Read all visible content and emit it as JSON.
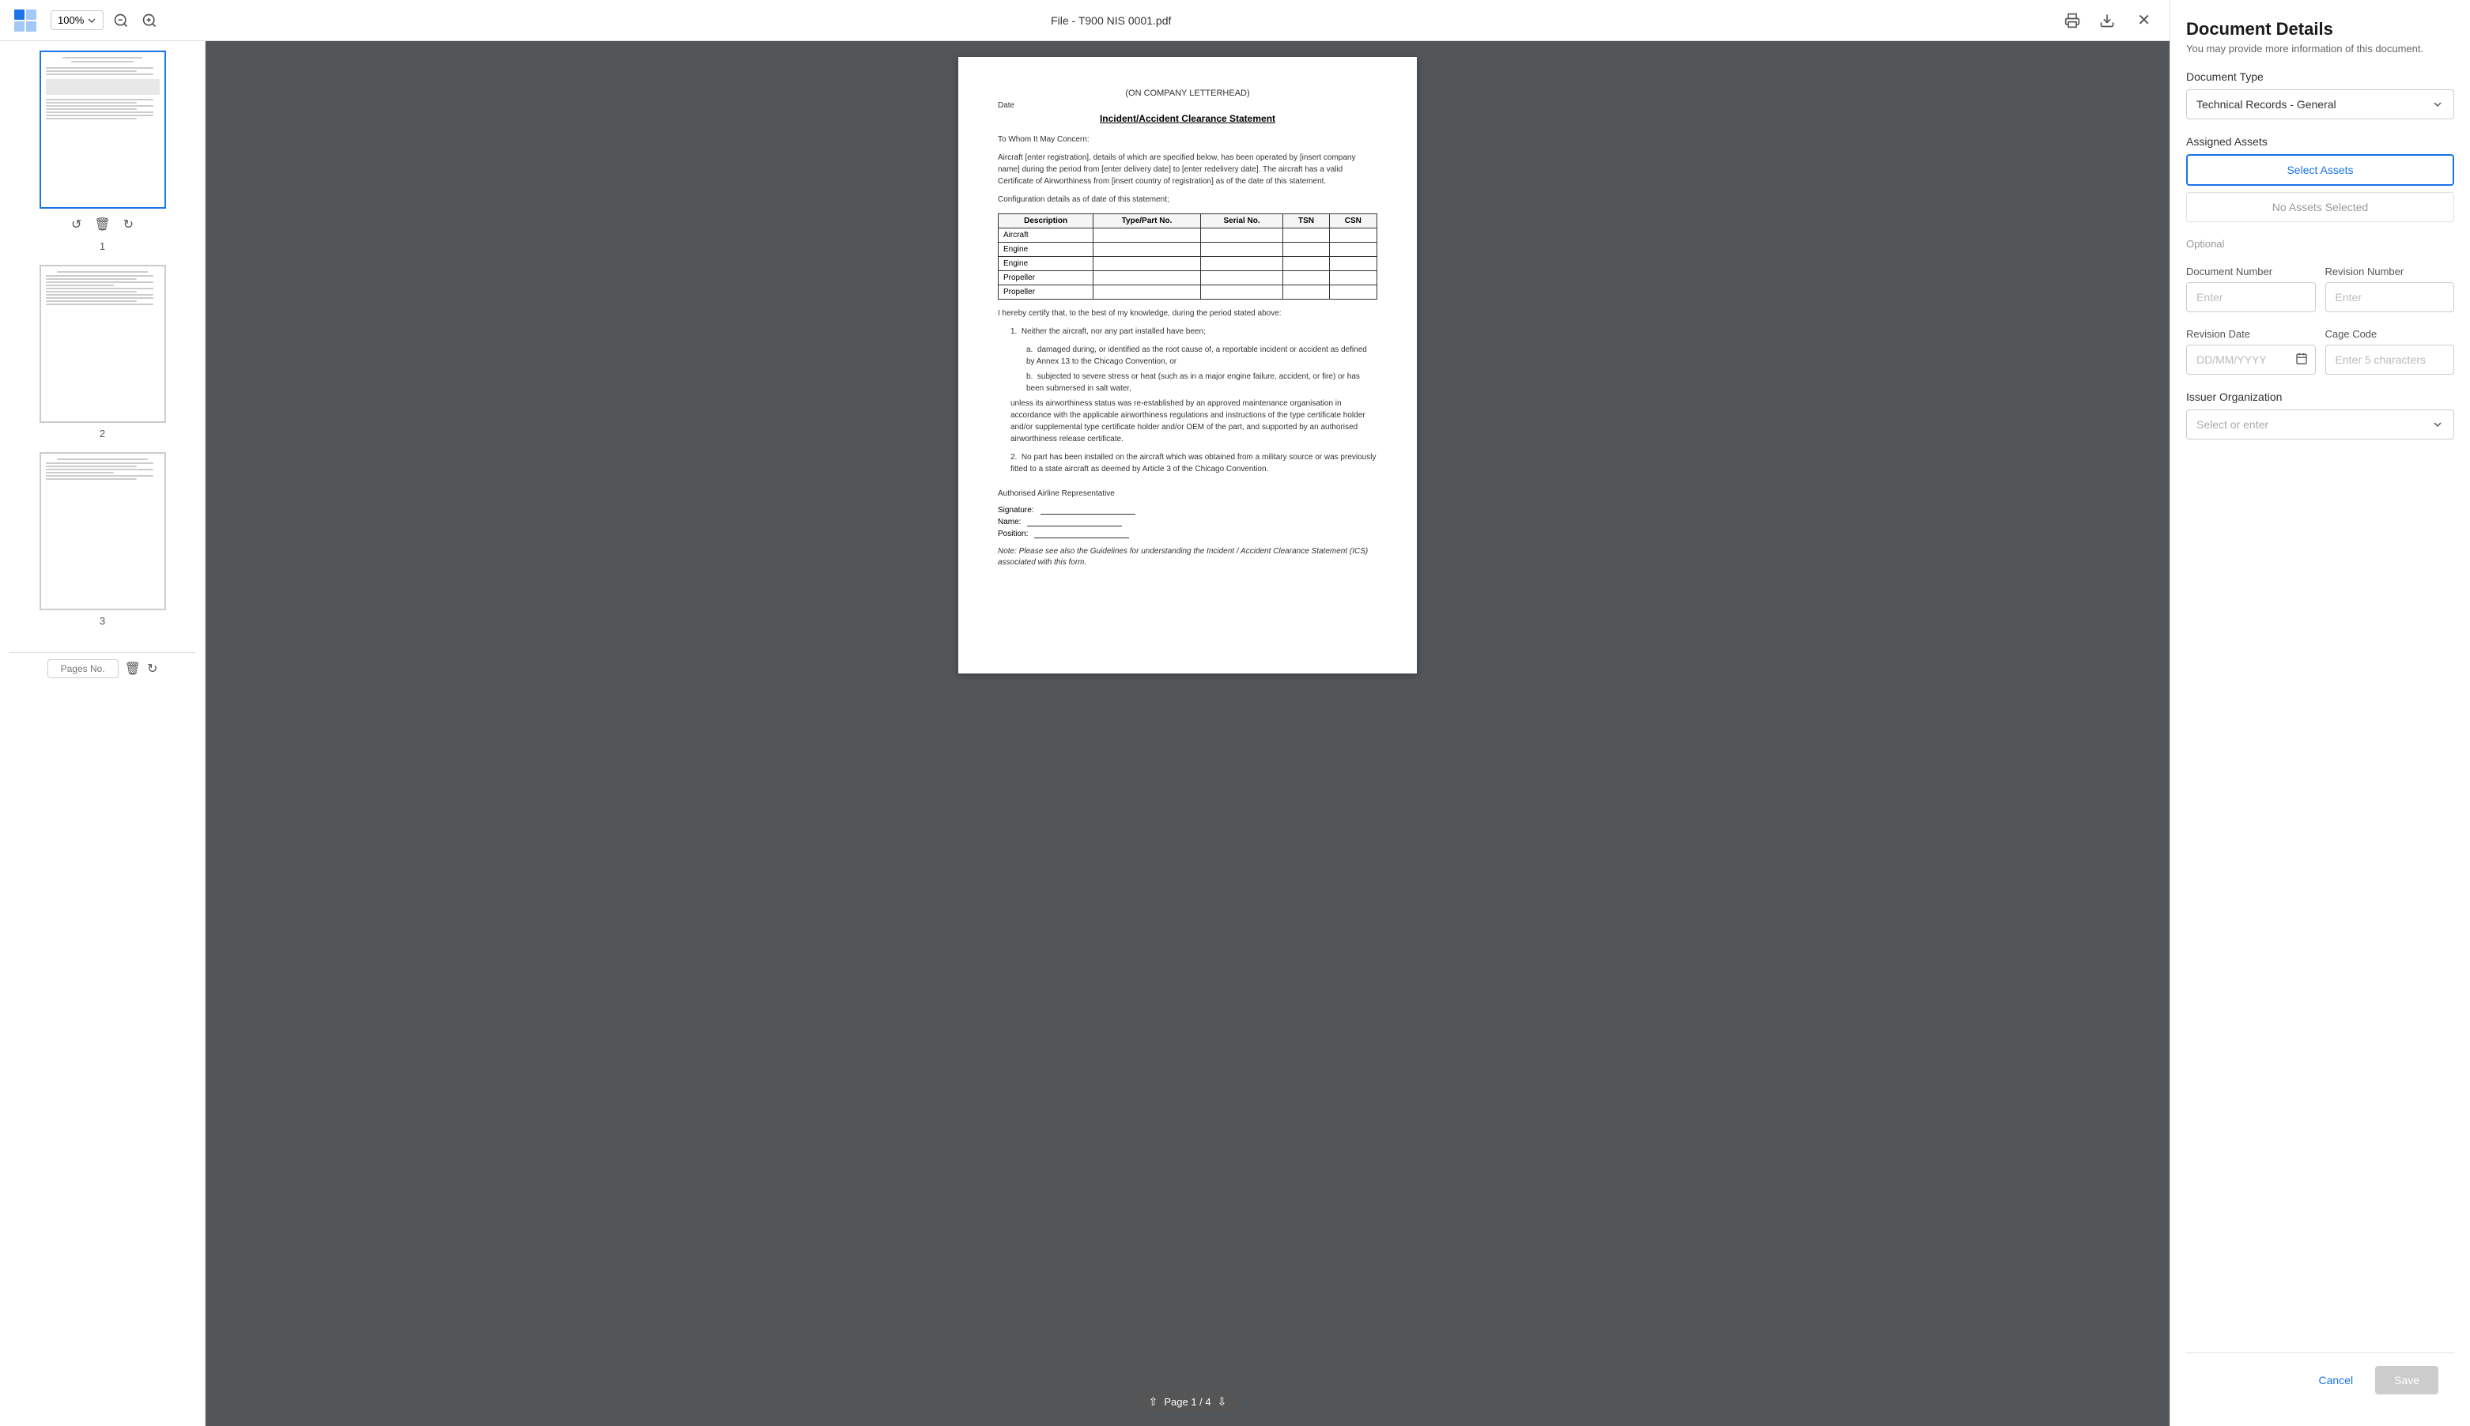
{
  "toolbar": {
    "zoom_level": "100%",
    "file_name": "File - T900 NIS 0001.pdf",
    "zoom_icon_in": "🔍+",
    "zoom_icon_out": "🔍-"
  },
  "thumbnails": [
    {
      "label": "1",
      "active": true
    },
    {
      "label": "2",
      "active": false
    },
    {
      "label": "3",
      "active": false
    }
  ],
  "bottom_bar": {
    "pages_label": "Pages No."
  },
  "pdf": {
    "letterhead": "(ON COMPANY LETTERHEAD)",
    "date_label": "Date",
    "title": "Incident/Accident Clearance Statement",
    "to_whom": "To Whom It May Concern:",
    "body1": "Aircraft [enter registration], details of which are specified below, has been operated by [insert company name] during the period from [enter delivery date] to [enter redelivery date]. The aircraft has a valid Certificate of Airworthiness from [insert country of registration] as of the date of this statement.",
    "config": "Configuration details as of date of this statement;",
    "table": {
      "headers": [
        "Description",
        "Type/Part No.",
        "Serial No.",
        "TSN",
        "CSN"
      ],
      "rows": [
        [
          "Aircraft",
          "",
          "",
          "",
          ""
        ],
        [
          "Engine",
          "",
          "",
          "",
          ""
        ],
        [
          "Engine",
          "",
          "",
          "",
          ""
        ],
        [
          "Propeller",
          "",
          "",
          "",
          ""
        ],
        [
          "Propeller",
          "",
          "",
          "",
          ""
        ]
      ]
    },
    "certify": "I hereby certify that, to the best of my knowledge, during the period stated above:",
    "point1": "Neither the aircraft, nor any part installed have been;",
    "point1a": "damaged during, or identified as the root cause of, a reportable incident or accident as defined by Annex 13 to the Chicago Convention, or",
    "point1b": "subjected to severe stress or heat (such as in a major engine failure, accident, or fire) or has been submersed in salt water,",
    "unless": "unless its airworthiness status was re-established by an approved maintenance organisation in accordance with the applicable airworthiness regulations and instructions of the type certificate holder and/or supplemental type certificate holder and/or OEM of the part, and supported by an authorised airworthiness release certificate.",
    "point2": "No part has been installed on the aircraft which was obtained from a military source or was previously fitted to a state aircraft as deemed by Article 3 of the Chicago Convention.",
    "authorised": "Authorised Airline Representative",
    "sig_label": "Signature:",
    "name_label": "Name:",
    "pos_label": "Position:",
    "note": "Note: Please see also the Guidelines for understanding the Incident / Accident Clearance Statement (ICS) associated with this form.",
    "page_nav": "Page 1 / 4"
  },
  "doc_details": {
    "title": "Document Details",
    "subtitle": "You may provide more information of this document.",
    "doc_type_label": "Document Type",
    "doc_type_value": "Technical Records - General",
    "assigned_assets_label": "Assigned Assets",
    "select_assets_btn": "Select Assets",
    "no_assets_text": "No Assets Selected",
    "optional_label": "Optional",
    "doc_number_label": "Document Number",
    "doc_number_placeholder": "Enter",
    "revision_number_label": "Revision Number",
    "revision_number_placeholder": "Enter",
    "revision_date_label": "Revision Date",
    "revision_date_placeholder": "DD/MM/YYYY",
    "cage_code_label": "Cage Code",
    "cage_code_placeholder": "Enter 5 characters",
    "issuer_org_label": "Issuer Organization",
    "issuer_org_placeholder": "Select or enter",
    "cancel_btn": "Cancel",
    "save_btn": "Save"
  }
}
